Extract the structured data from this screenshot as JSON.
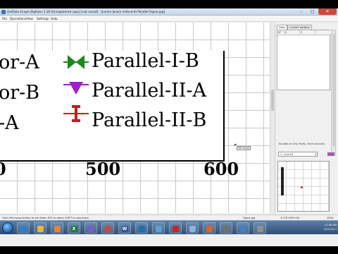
{
  "window": {
    "title": "GetData Graph Digitizer 2.26 [Unregistered copy] [not saved] - [Lorem Ipsum (ndecent) Parallel Figure.jpg]",
    "min_glyph": "–",
    "max_glyph": "□",
    "close_glyph": "✕"
  },
  "menu": [
    "File",
    "Operations",
    "View",
    "Settings",
    "Help"
  ],
  "plot": {
    "legend_entries": [
      {
        "label": "or-A",
        "marker": "none"
      },
      {
        "label": "Parallel-I-B",
        "marker": "bowtie",
        "color": "#1a8a1a"
      },
      {
        "label": "or-B",
        "marker": "none"
      },
      {
        "label": "Parallel-II-A",
        "marker": "triangle-down",
        "color": "#a020c0"
      },
      {
        "label": "-A",
        "marker": "none"
      },
      {
        "label": "Parallel-II-B",
        "marker": "i-beam",
        "color": "#c02020"
      }
    ],
    "x_tick_labels": [
      "500",
      "600"
    ],
    "tooltip": "Set linear"
  },
  "right_panel": {
    "tabs": [
      "Data",
      "Current location"
    ],
    "table_columns": [
      "N°",
      "X",
      "Y"
    ],
    "no_data_message": "No data on Grid, Points, Trace and Area",
    "curve_select": "1 - Line #1",
    "curve_color": "#cc44cc"
  },
  "status": {
    "hint": "Click left mouse button to set linear; ESC to abort; SHIFT to skip linear",
    "file": "Figure.jpg",
    "coords": "3.27E+00E+00",
    "zoom": "100%"
  },
  "taskbar": {
    "buttons": [
      {
        "label": "",
        "icon": "ie-icon",
        "color": "#2a7fd4"
      },
      {
        "label": "",
        "icon": "folder-icon",
        "color": "#e8b838"
      },
      {
        "label": "",
        "icon": "media-player-icon",
        "color": "#f08030"
      },
      {
        "label": "X",
        "icon": "excel-icon",
        "color": "#1e7a3c"
      },
      {
        "label": "",
        "icon": "app-icon",
        "color": "#7a5cc8"
      },
      {
        "label": "",
        "icon": "chrome-icon",
        "color": "#d64040"
      },
      {
        "label": "W",
        "icon": "word-icon",
        "color": "#2b579a"
      },
      {
        "label": "",
        "icon": "outlook-icon",
        "color": "#1d6fb8"
      },
      {
        "label": "",
        "icon": "getdata-icon",
        "color": "#5aa0d8"
      },
      {
        "label": "",
        "icon": "acrobat-icon",
        "color": "#d02020"
      },
      {
        "label": "",
        "icon": "explorer-icon",
        "color": "#8ab4e0"
      },
      {
        "label": "",
        "icon": "paint-icon",
        "color": "#e06030"
      },
      {
        "label": "",
        "icon": "calculator-icon",
        "color": "#707070"
      },
      {
        "label": "",
        "icon": "network-icon",
        "color": "#4080c0"
      },
      {
        "label": "",
        "icon": "misc-icon",
        "color": "#909090"
      }
    ],
    "clock_time": "11:08 AM",
    "clock_date": "2/22/2017"
  }
}
